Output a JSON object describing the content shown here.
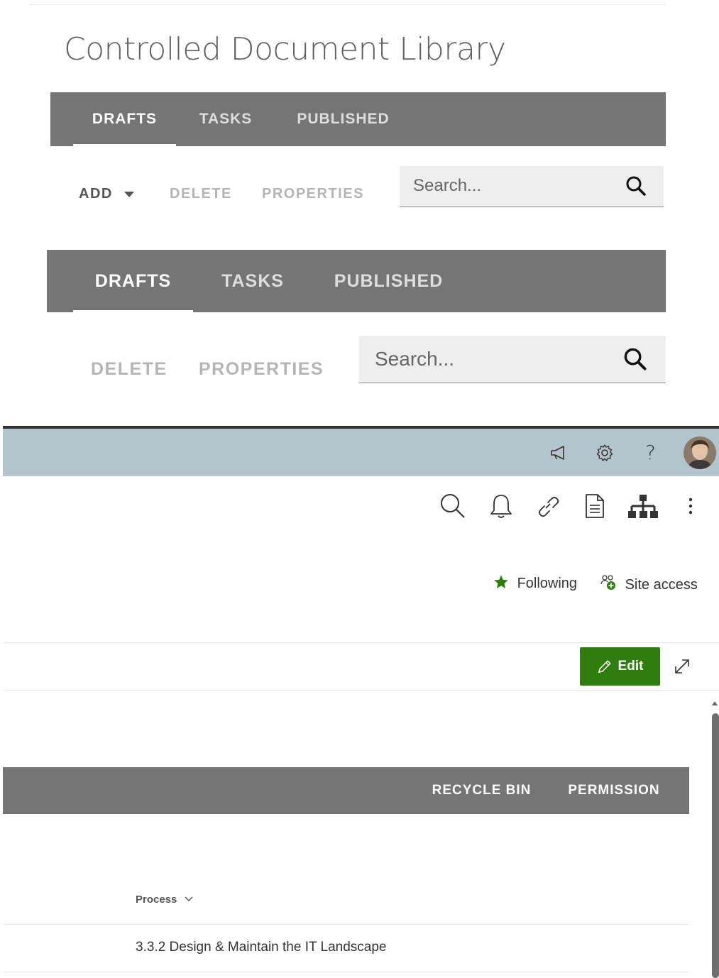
{
  "library": {
    "title": "Controlled Document Library"
  },
  "tabs_top": [
    "DRAFTS",
    "TASKS",
    "PUBLISHED"
  ],
  "toolbar_top": {
    "add_label": "ADD",
    "delete_label": "DELETE",
    "properties_label": "PROPERTIES",
    "search_placeholder": "Search..."
  },
  "tabs_second": [
    "DRAFTS",
    "TASKS",
    "PUBLISHED"
  ],
  "toolbar_second": {
    "delete_label": "DELETE",
    "properties_label": "PROPERTIES",
    "search_placeholder": "Search..."
  },
  "site_header": {
    "icons": [
      "megaphone-icon",
      "gear-icon",
      "help-icon",
      "avatar"
    ],
    "help_glyph": "?"
  },
  "page_toolbar": {
    "icons": [
      "search-icon",
      "bell-icon",
      "link-icon",
      "document-icon",
      "sitemap-icon",
      "more-icon"
    ]
  },
  "site_actions": {
    "following_label": "Following",
    "site_access_label": "Site access"
  },
  "edit_bar": {
    "edit_label": "Edit"
  },
  "lib_tabbar": {
    "recycle_bin_label": "RECYCLE BIN",
    "permission_label": "PERMISSION"
  },
  "list": {
    "column_header": "Process",
    "rows": [
      "3.3.2 Design & Maintain the IT Landscape"
    ]
  },
  "colors": {
    "tab_bar": "#757575",
    "site_header": "#b4c4cd",
    "edit_button": "#2f7d0f",
    "following_star": "#2f7d0f"
  }
}
